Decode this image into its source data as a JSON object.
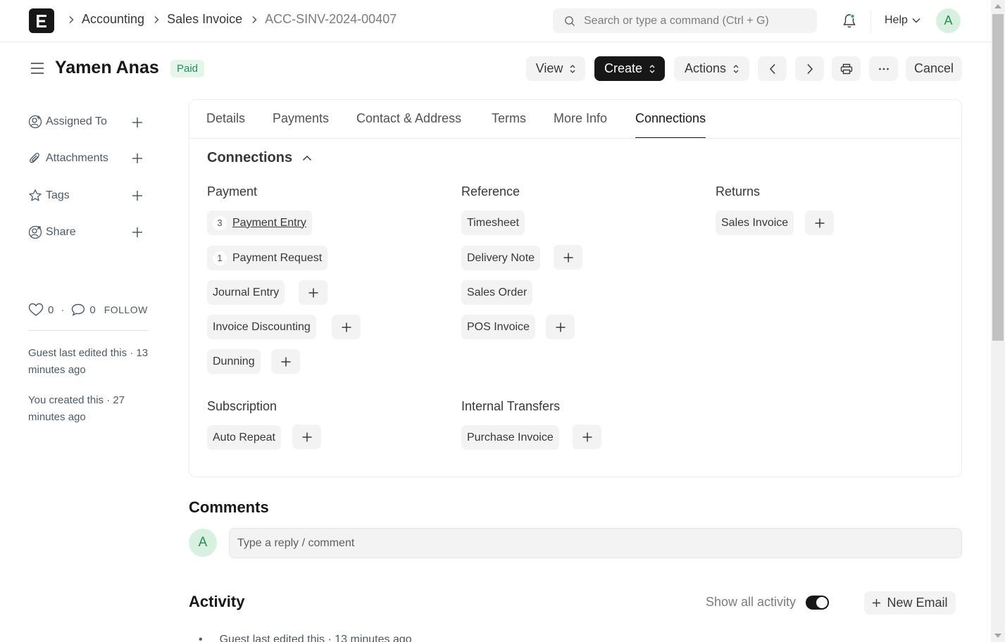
{
  "navbar": {
    "breadcrumbs": [
      "Accounting",
      "Sales Invoice",
      "ACC-SINV-2024-00407"
    ],
    "search_placeholder": "Search or type a command (Ctrl + G)",
    "help_label": "Help",
    "avatar_initial": "A"
  },
  "page": {
    "title": "Yamen Anas",
    "status": "Paid",
    "buttons": {
      "view": "View",
      "create": "Create",
      "actions": "Actions",
      "cancel": "Cancel"
    }
  },
  "sidebar": {
    "items": [
      {
        "label": "Assigned To",
        "icon": "user-plus-icon"
      },
      {
        "label": "Attachments",
        "icon": "paperclip-icon"
      },
      {
        "label": "Tags",
        "icon": "star-icon"
      },
      {
        "label": "Share",
        "icon": "share-user-icon"
      }
    ],
    "likes": "0",
    "comments": "0",
    "follow": "FOLLOW",
    "edited_text": "Guest last edited this · 13 minutes ago",
    "created_text": "You created this · 27 minutes ago"
  },
  "tabs": [
    "Details",
    "Payments",
    "Contact & Address",
    "Terms",
    "More Info",
    "Connections"
  ],
  "connections": {
    "heading": "Connections",
    "groups": {
      "payment": {
        "title": "Payment",
        "items": [
          {
            "label": "Payment Entry",
            "count": "3"
          },
          {
            "label": "Payment Request",
            "count": "1"
          },
          {
            "label": "Journal Entry"
          },
          {
            "label": "Invoice Discounting"
          },
          {
            "label": "Dunning"
          }
        ]
      },
      "reference": {
        "title": "Reference",
        "items": [
          {
            "label": "Timesheet"
          },
          {
            "label": "Delivery Note"
          },
          {
            "label": "Sales Order"
          },
          {
            "label": "POS Invoice"
          }
        ]
      },
      "returns": {
        "title": "Returns",
        "items": [
          {
            "label": "Sales Invoice"
          }
        ]
      },
      "subscription": {
        "title": "Subscription",
        "items": [
          {
            "label": "Auto Repeat"
          }
        ]
      },
      "internal_transfers": {
        "title": "Internal Transfers",
        "items": [
          {
            "label": "Purchase Invoice"
          }
        ]
      }
    }
  },
  "comments": {
    "title": "Comments",
    "avatar_initial": "A",
    "placeholder": "Type a reply / comment"
  },
  "activity": {
    "title": "Activity",
    "show_all_label": "Show all activity",
    "show_all_enabled": true,
    "new_email_label": "New Email",
    "first_entry": "Guest last edited this · 13 minutes ago"
  }
}
